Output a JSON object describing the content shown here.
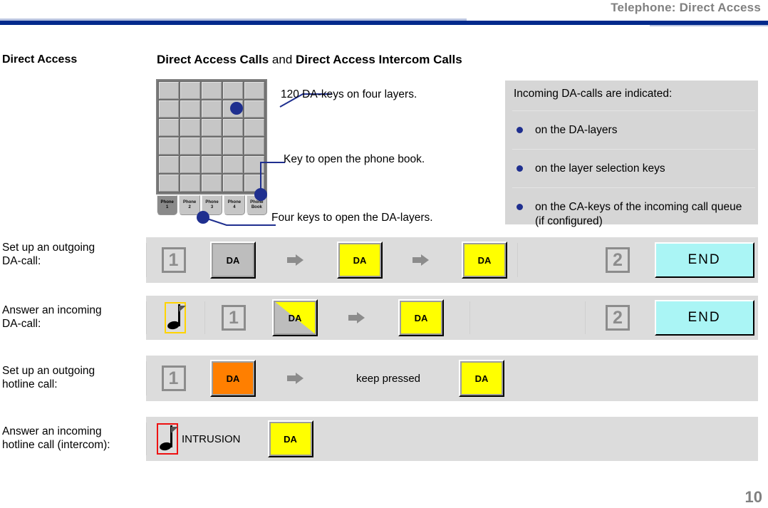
{
  "header": {
    "title": "Telephone: Direct Access",
    "rule_color": "#032a8c"
  },
  "section": {
    "label": "Direct Access",
    "heading_part1": "Direct Access Calls",
    "heading_conj": " and ",
    "heading_part2": "Direct Access Intercom Calls"
  },
  "keypad": {
    "rows": 6,
    "columns": 5,
    "layer_tabs": [
      {
        "line1": "Phone",
        "line2": "1",
        "active": true
      },
      {
        "line1": "Phone",
        "line2": "2",
        "active": false
      },
      {
        "line1": "Phone",
        "line2": "3",
        "active": false
      },
      {
        "line1": "Phone",
        "line2": "4",
        "active": false
      },
      {
        "line1": "Phone",
        "line2": "Book",
        "active": false
      }
    ]
  },
  "callouts": {
    "da_keys": "120 DA-keys on four layers.",
    "phone_book": "Key to open the phone book.",
    "da_layers": "Four keys to open the DA-layers."
  },
  "info_box": {
    "title": "Incoming DA-calls are indicated:",
    "items": [
      "on the DA-layers",
      "on the layer selection keys",
      "on the CA-keys of the incoming call queue (if configured)"
    ],
    "bullet_color": "#1f2f8f"
  },
  "procedures": [
    {
      "label_line1": "Set up an outgoing",
      "label_line2": "DA-call:",
      "step1": "1",
      "step2": "2",
      "key_da": "DA",
      "key_end": "END"
    },
    {
      "label_line1": "Answer an incoming",
      "label_line2": "DA-call:",
      "step1": "1",
      "step2": "2",
      "key_da": "DA",
      "key_end": "END"
    },
    {
      "label_line1": "Set up an outgoing",
      "label_line2": "hotline call:",
      "step1": "1",
      "key_da": "DA",
      "note": "keep pressed"
    },
    {
      "label_line1": "Answer an incoming",
      "label_line2": "hotline call (intercom):",
      "intrusion": "INTRUSION",
      "key_da": "DA"
    }
  ],
  "page_number": "10"
}
